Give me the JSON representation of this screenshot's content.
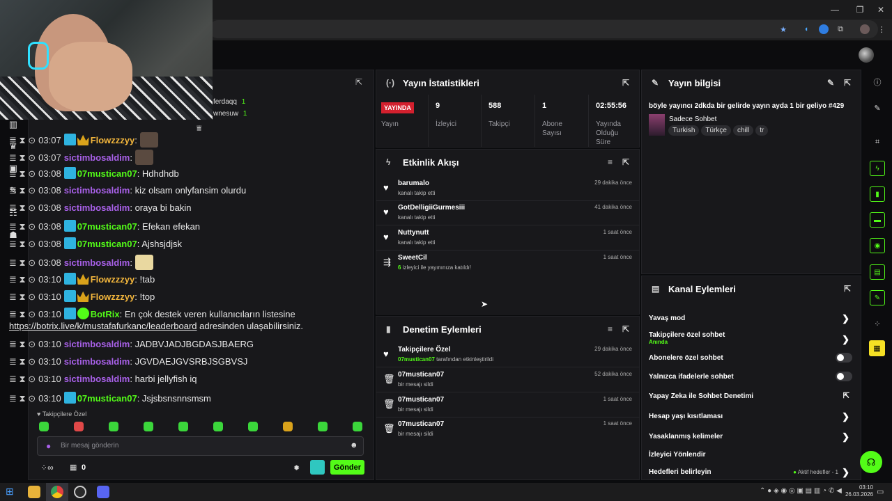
{
  "window": {
    "minimize": "—",
    "restore": "❐",
    "close": "✕"
  },
  "chat": {
    "header_users": [
      {
        "name": "ferdaqq",
        "count": "1"
      },
      {
        "name": "wnesuw",
        "count": "1"
      }
    ],
    "lines": [
      {
        "time": "03:07",
        "user": "Flowzzzyy",
        "color": "yel",
        "badges": [
          "blue",
          "crown"
        ],
        "text": "",
        "emote": true
      },
      {
        "time": "03:07",
        "user": "sictimbosaldim",
        "color": "pur",
        "badges": [],
        "text": "",
        "emote": true
      },
      {
        "time": "03:08",
        "user": "07mustican07",
        "color": "grn",
        "badges": [
          "blue"
        ],
        "text": "Hdhdhdb"
      },
      {
        "time": "03:08",
        "user": "sictimbosaldim",
        "color": "pur",
        "badges": [],
        "text": "kiz olsam onlyfansim olurdu"
      },
      {
        "time": "03:08",
        "user": "sictimbosaldim",
        "color": "pur",
        "badges": [],
        "text": "oraya bi bakin"
      },
      {
        "time": "03:08",
        "user": "07mustican07",
        "color": "grn",
        "badges": [
          "blue"
        ],
        "text": "Efekan efekan"
      },
      {
        "time": "03:08",
        "user": "07mustican07",
        "color": "grn",
        "badges": [
          "blue"
        ],
        "text": "Ajshsjdjsk"
      },
      {
        "time": "03:08",
        "user": "sictimbosaldim",
        "color": "pur",
        "badges": [],
        "text": "",
        "emote": true
      },
      {
        "time": "03:10",
        "user": "Flowzzzyy",
        "color": "yel",
        "badges": [
          "blue",
          "crown"
        ],
        "text": "!tab"
      },
      {
        "time": "03:10",
        "user": "Flowzzzyy",
        "color": "yel",
        "badges": [
          "blue",
          "crown"
        ],
        "text": "!top"
      },
      {
        "time": "03:10",
        "user": "BotRix",
        "color": "grn",
        "badges": [
          "blue",
          "green"
        ],
        "text": "En çok destek veren kullanıcıların listesine"
      },
      {
        "time": "03:10",
        "user": "sictimbosaldim",
        "color": "pur",
        "badges": [],
        "text": "JADBVJADJBGDASJBAERG"
      },
      {
        "time": "03:10",
        "user": "sictimbosaldim",
        "color": "pur",
        "badges": [],
        "text": "JGVDAEJGVSRBJSGBVSJ"
      },
      {
        "time": "03:10",
        "user": "sictimbosaldim",
        "color": "pur",
        "badges": [],
        "text": "harbi jellyfish iq"
      },
      {
        "time": "03:10",
        "user": "07mustican07",
        "color": "grn",
        "badges": [
          "blue"
        ],
        "text": "Jsjsbsnsnnsmsm"
      }
    ],
    "botrix_link": "https://botrix.live/k/mustafafurkanc/leaderboard",
    "botrix_tail": " adresinden ulaşabilirsiniz.",
    "mode_label": "Takipçilere Özel",
    "input_placeholder": "Bir mesaj gönderin",
    "infinity": "∞",
    "gift_count": "0",
    "send_label": "Gönder"
  },
  "stats": {
    "title": "Yayın İstatistikleri",
    "live_badge": "YAYINDA",
    "live_label": "Yayın",
    "items": [
      {
        "value": "9",
        "label": "İzleyici"
      },
      {
        "value": "588",
        "label": "Takipçi"
      },
      {
        "value": "1",
        "label": "Abone Sayısı"
      },
      {
        "value": "02:55:56",
        "label": "Yayında Olduğu Süre"
      }
    ]
  },
  "activity": {
    "title": "Etkinlik Akışı",
    "items": [
      {
        "name": "barumalo",
        "desc": "kanalı takip etti",
        "time": "29 dakika önce",
        "icon": "heart"
      },
      {
        "name": "GotDelligiiGurmesiii",
        "desc": "kanalı takip etti",
        "time": "41 dakika önce",
        "icon": "heart"
      },
      {
        "name": "Nuttynutt",
        "desc": "kanalı takip etti",
        "time": "1 saat önce",
        "icon": "heart"
      },
      {
        "name": "SweetCil",
        "desc_num": "6",
        "desc": " izleyici ile yayınınıza katıldı!",
        "time": "1 saat önce",
        "icon": "raid"
      }
    ]
  },
  "moderation": {
    "title": "Denetim Eylemleri",
    "items": [
      {
        "name": "Takipçilere Özel",
        "actor": "07mustican07",
        "desc": " tarafından etkinleştirildi",
        "time": "29 dakika önce"
      },
      {
        "name": "07mustican07",
        "desc": "bir mesajı sildi",
        "time": "52 dakika önce"
      },
      {
        "name": "07mustican07",
        "desc": "bir mesajı sildi",
        "time": "1 saat önce"
      },
      {
        "name": "07mustican07",
        "desc": "bir mesajı sildi",
        "time": "1 saat önce"
      }
    ]
  },
  "info": {
    "title": "Yayın bilgisi",
    "stream_title": "böyle yayıncı 2dkda bir gelirde yayın ayda 1 bir geliyo #429",
    "category": "Sadece Sohbet",
    "tags": [
      "Turkish",
      "Türkçe",
      "chill",
      "tr"
    ]
  },
  "channel": {
    "title": "Kanal Eylemleri",
    "rows": [
      {
        "label": "Yavaş mod",
        "type": "chevron"
      },
      {
        "label": "Takipçilere özel sohbet",
        "sub": "Anında",
        "type": "chevron"
      },
      {
        "label": "Abonelere özel sohbet",
        "type": "toggle"
      },
      {
        "label": "Yalnızca ifadelerle sohbet",
        "type": "toggle"
      },
      {
        "label": "Yapay Zeka ile Sohbet Denetimi",
        "type": "external"
      },
      {
        "label": "Hesap yaşı kısıtlaması",
        "type": "chevron"
      },
      {
        "label": "Yasaklanmış kelimeler",
        "type": "chevron"
      },
      {
        "label": "İzleyici Yönlendir",
        "type": "none"
      },
      {
        "label": "Hedefleri belirleyin",
        "type": "chevron",
        "extra": "Aktif hedefler - 1"
      }
    ]
  },
  "taskbar": {
    "time": "03:10",
    "date": "26.03.2026"
  },
  "colors": {
    "accent": "#53fc18",
    "panel": "#18181b",
    "purple_user": "#a860e8",
    "yellow_user": "#f3b63c"
  }
}
